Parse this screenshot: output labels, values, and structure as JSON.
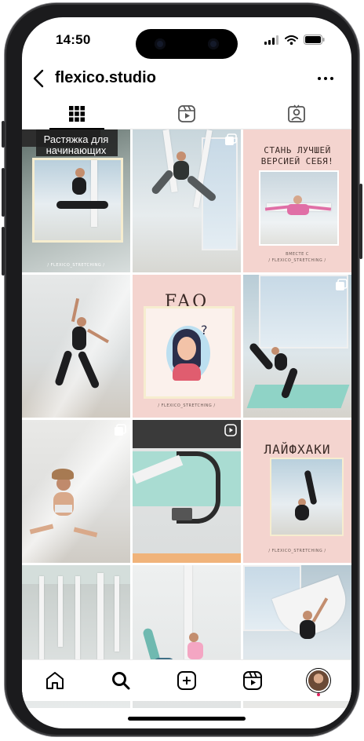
{
  "status_bar": {
    "time": "14:50"
  },
  "header": {
    "username": "flexico.studio"
  },
  "tabs": [
    {
      "name": "posts-grid",
      "icon": "grid-icon",
      "active": true
    },
    {
      "name": "reels",
      "icon": "reels-icon",
      "active": false
    },
    {
      "name": "tagged",
      "icon": "tagged-icon",
      "active": false
    }
  ],
  "posts": {
    "p1": {
      "title": "Растяжка для начинающих",
      "footer": "/ FLEXICO_STRETCHING /"
    },
    "p3": {
      "title": "СТАНЬ ЛУЧШЕЙ ВЕРСИЕЙ СЕБЯ!",
      "sub": "ВМЕСТЕ С",
      "footer": "/ FLEXICO_STRETCHING /"
    },
    "p5": {
      "title": "FAQ",
      "footer": "/ FLEXICO_STRETCHING /"
    },
    "p9": {
      "title": "ЛАЙФХАКИ",
      "footer": "/ FLEXICO_STRETCHING /"
    }
  },
  "bottom_nav": [
    "home-icon",
    "search-icon",
    "create-icon",
    "reels-icon",
    "profile-avatar"
  ],
  "colors": {
    "accent_pink": "#f4d4cf",
    "mat_teal": "#8fd3c6",
    "notification_dot": "#e0245e"
  }
}
